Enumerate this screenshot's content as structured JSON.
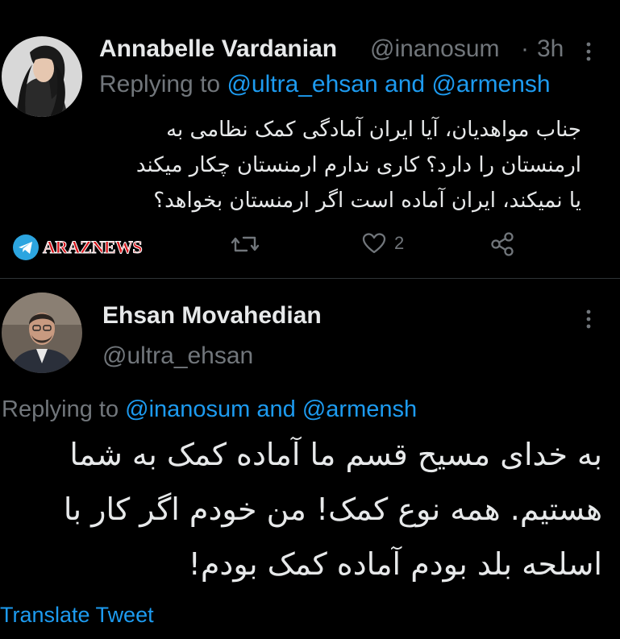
{
  "tweet1": {
    "author_name": "Annabelle Vardanian",
    "handle": "@inanosum",
    "time_sep": "·",
    "time": "3h",
    "replying_prefix": "Replying to",
    "replying_user1": "@ultra_ehsan",
    "replying_and": "and",
    "replying_user2": "@armensh",
    "text_lines": [
      "جناب مواهدیان، آیا ایران آمادگی کمک نظامی به",
      "ارمنستان را دارد؟ کاری ندارم ارمنستان چکار میکند",
      "یا نمیکند، ایران آماده است اگر ارمنستان بخواهد؟"
    ],
    "like_count": "2"
  },
  "watermark": {
    "text": "ARAZNEWS"
  },
  "tweet2": {
    "author_name": "Ehsan Movahedian",
    "handle": "@ultra_ehsan",
    "replying_prefix": "Replying to",
    "replying_user1": "@inanosum",
    "replying_and": "and",
    "replying_user2": "@armensh",
    "text_lines": [
      "به خدای مسیح قسم ما آماده کمک به شما",
      "هستیم. همه نوع کمک! من خودم اگر کار با",
      "اسلحه بلد بودم آماده کمک بودم!"
    ],
    "translate_label": "Translate Tweet"
  },
  "icons": {
    "more": "more-vertical-icon",
    "reply": "reply-icon",
    "retweet": "retweet-icon",
    "like": "heart-icon",
    "share": "share-icon",
    "telegram": "telegram-icon"
  },
  "colors": {
    "background": "#000000",
    "text": "#e7e9ea",
    "secondary": "#71767b",
    "link": "#1d9bf0",
    "watermark_red": "#d7141a"
  }
}
